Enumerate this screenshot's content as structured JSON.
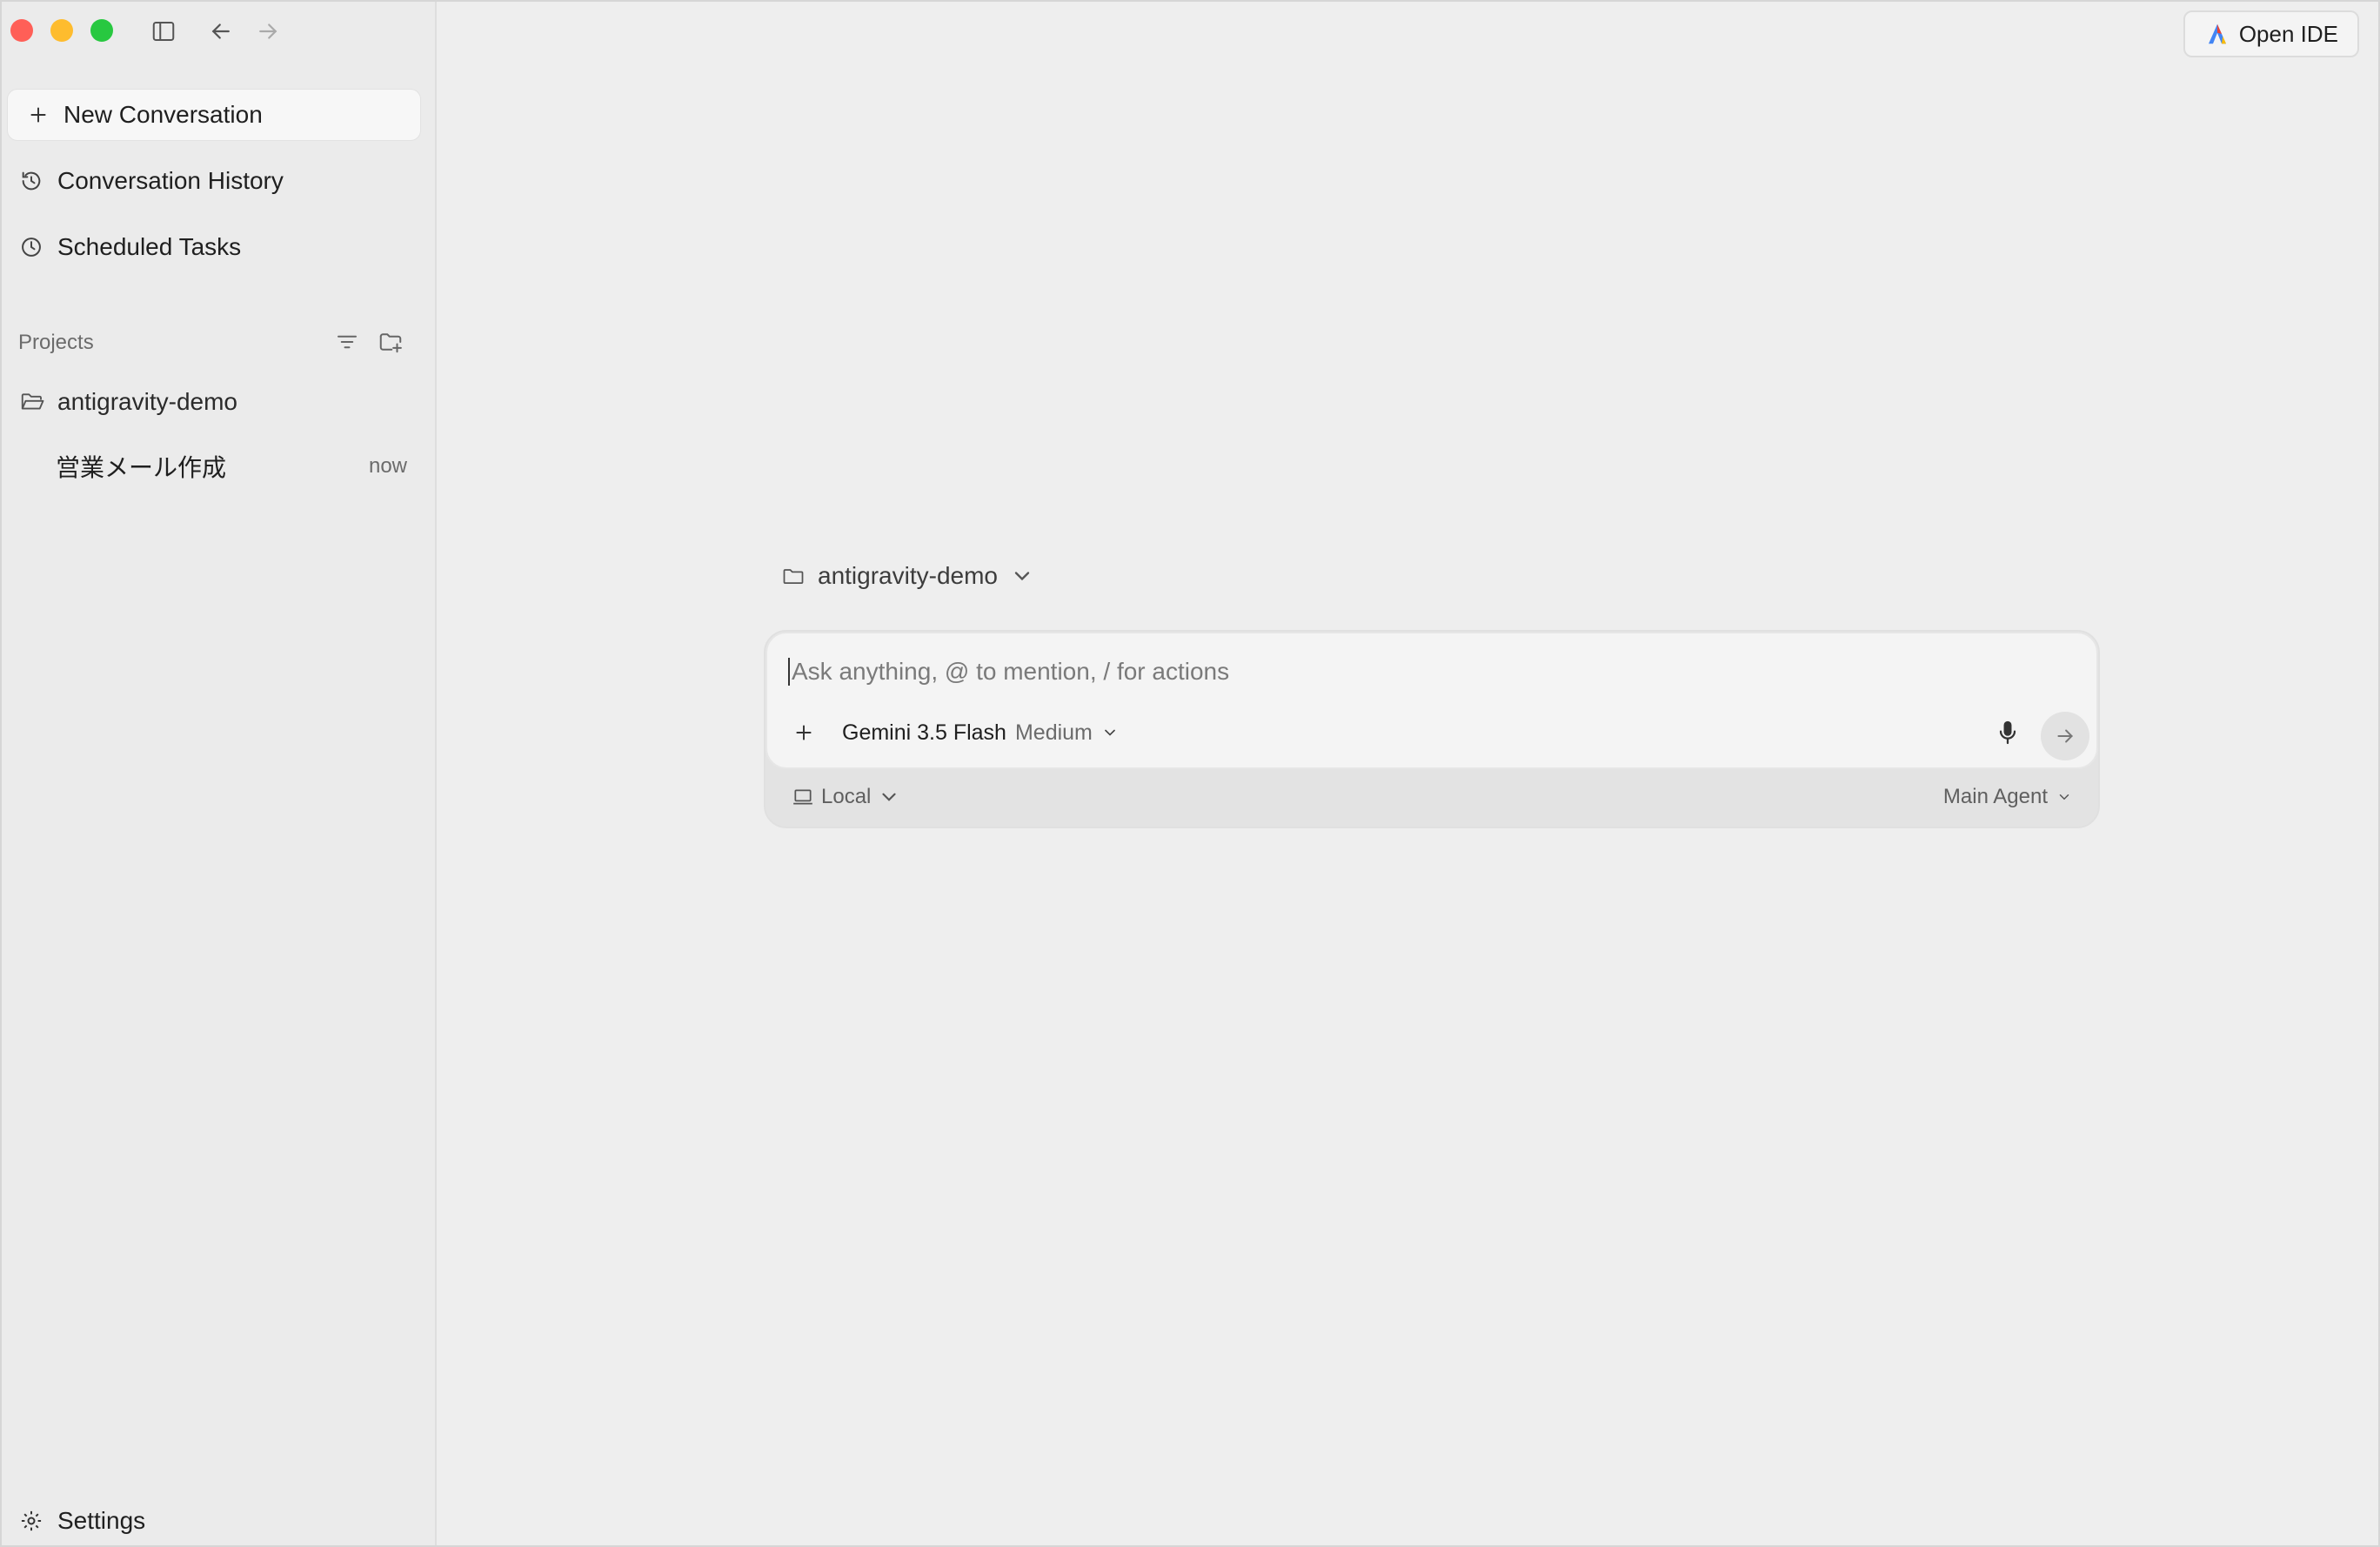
{
  "sidebar": {
    "new_conversation": "New Conversation",
    "nav": [
      {
        "label": "Conversation History",
        "icon": "history-icon"
      },
      {
        "label": "Scheduled Tasks",
        "icon": "clock-icon"
      }
    ],
    "projects_label": "Projects",
    "project": {
      "name": "antigravity-demo",
      "icon": "folder-open-icon"
    },
    "conversations": [
      {
        "title": "営業メール作成",
        "time": "now"
      }
    ],
    "settings": "Settings"
  },
  "header": {
    "open_ide": "Open IDE"
  },
  "composer": {
    "folder": "antigravity-demo",
    "placeholder": "Ask anything, @ to mention, / for actions",
    "model": "Gemini 3.5 Flash",
    "effort": "Medium",
    "environment": "Local",
    "agent": "Main Agent"
  },
  "colors": {
    "close": "#ff5f57",
    "minimize": "#febc2e",
    "zoom": "#28c840",
    "background": "#eeeeee",
    "sidebar": "#ebebeb"
  }
}
